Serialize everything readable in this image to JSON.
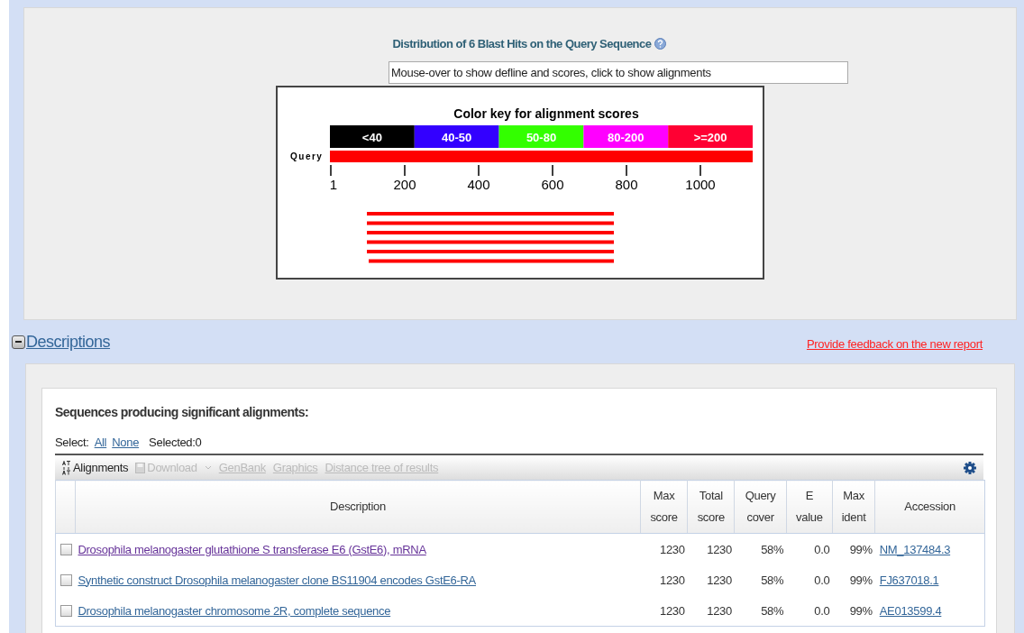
{
  "graphic": {
    "title": "Distribution of 6 Blast Hits on the Query Sequence",
    "hint": "Mouse-over to show defline and scores, click to show alignments",
    "key_title": "Color key for alignment scores",
    "color_key": [
      {
        "label": "<40",
        "color": "#000000"
      },
      {
        "label": "40-50",
        "color": "#3300ff"
      },
      {
        "label": "50-80",
        "color": "#33ff00"
      },
      {
        "label": "80-200",
        "color": "#ff00ff"
      },
      {
        "label": ">=200",
        "color": "#ff0033"
      }
    ],
    "query_label": "Query",
    "ticks": [
      "1",
      "200",
      "400",
      "600",
      "800",
      "1000"
    ]
  },
  "descriptions": {
    "title": "Descriptions",
    "expanded": true,
    "feedback_link": "Provide feedback on the new report",
    "heading": "Sequences producing significant alignments:",
    "select_label": "Select:",
    "select_all": "All",
    "select_none": "None",
    "selected_count": "Selected:0",
    "toolbar": [
      {
        "label": "Alignments",
        "disabled": false,
        "kind": "sort"
      },
      {
        "label": "Download",
        "disabled": true,
        "kind": "download"
      },
      {
        "label": "GenBank",
        "disabled": true,
        "kind": "link"
      },
      {
        "label": "Graphics",
        "disabled": true,
        "kind": "link"
      },
      {
        "label": "Distance tree of results",
        "disabled": true,
        "kind": "link"
      }
    ],
    "columns": [
      [
        "Description"
      ],
      [
        "Max",
        "score"
      ],
      [
        "Total",
        "score"
      ],
      [
        "Query",
        "cover"
      ],
      [
        "E",
        "value"
      ],
      [
        "Max",
        "ident"
      ],
      [
        "Accession"
      ]
    ],
    "rows": [
      {
        "checked": false,
        "visited": true,
        "description": "Drosophila melanogaster glutathione S transferase E6 (GstE6), mRNA",
        "max_score": "1230",
        "total_score": "1230",
        "query_cover": "58%",
        "e_value": "0.0",
        "max_ident": "99%",
        "accession": "NM_137484.3"
      },
      {
        "checked": false,
        "visited": false,
        "description": "Synthetic construct Drosophila melanogaster clone BS11904 encodes GstE6-RA",
        "max_score": "1230",
        "total_score": "1230",
        "query_cover": "58%",
        "e_value": "0.0",
        "max_ident": "99%",
        "accession": "FJ637018.1"
      },
      {
        "checked": false,
        "visited": false,
        "description": "Drosophila melanogaster chromosome 2R, complete sequence",
        "max_score": "1230",
        "total_score": "1230",
        "query_cover": "58%",
        "e_value": "0.0",
        "max_ident": "99%",
        "accession": "AE013599.4"
      }
    ]
  }
}
